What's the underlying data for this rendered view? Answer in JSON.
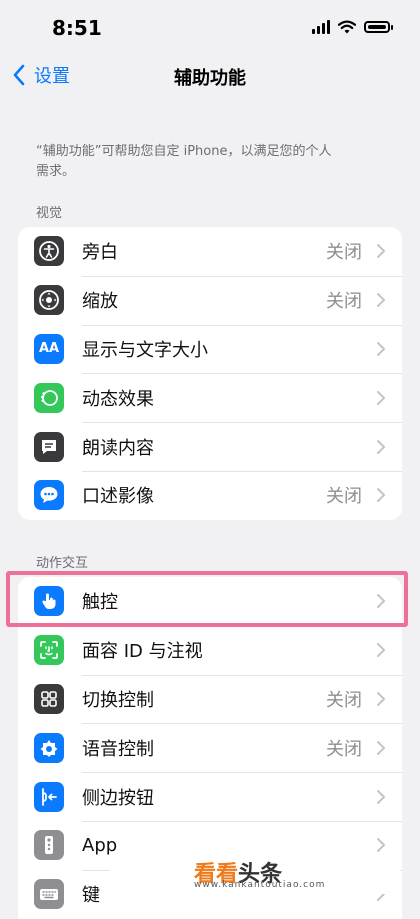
{
  "status_bar": {
    "time": "8:51"
  },
  "nav": {
    "back_label": "设置",
    "title": "辅助功能"
  },
  "description": "“辅助功能”可帮助您自定 iPhone，以满足您的个人需求。",
  "sections": [
    {
      "header": "视觉",
      "items": [
        {
          "label": "旁白",
          "value": "关闭",
          "icon": "voiceover-icon",
          "color": "#3a3a3c"
        },
        {
          "label": "缩放",
          "value": "关闭",
          "icon": "zoom-icon",
          "color": "#3a3a3c"
        },
        {
          "label": "显示与文字大小",
          "value": "",
          "icon": "text-size-icon",
          "glyph": "AA",
          "color": "#0a7aff"
        },
        {
          "label": "动态效果",
          "value": "",
          "icon": "motion-icon",
          "color": "#34c759"
        },
        {
          "label": "朗读内容",
          "value": "",
          "icon": "spoken-content-icon",
          "color": "#3a3a3c"
        },
        {
          "label": "口述影像",
          "value": "关闭",
          "icon": "audio-description-icon",
          "color": "#0a7aff"
        }
      ]
    },
    {
      "header": "动作交互",
      "items": [
        {
          "label": "触控",
          "value": "",
          "icon": "touch-icon",
          "color": "#0a7aff"
        },
        {
          "label": "面容 ID 与注视",
          "value": "",
          "icon": "face-id-icon",
          "color": "#34c759"
        },
        {
          "label": "切换控制",
          "value": "关闭",
          "icon": "switch-control-icon",
          "color": "#3a3a3c"
        },
        {
          "label": "语音控制",
          "value": "关闭",
          "icon": "voice-control-icon",
          "color": "#0a7aff"
        },
        {
          "label": "侧边按钮",
          "value": "",
          "icon": "side-button-icon",
          "color": "#0a7aff"
        },
        {
          "label": "App",
          "value": "",
          "icon": "apple-tv-remote-icon",
          "color": "#8e8e93"
        },
        {
          "label": "键",
          "value": "",
          "icon": "keyboard-icon",
          "color": "#8e8e93"
        }
      ]
    }
  ],
  "watermark": {
    "brand_a": "看看",
    "brand_b": "头条",
    "url": "www.kankantoutiao.com"
  }
}
